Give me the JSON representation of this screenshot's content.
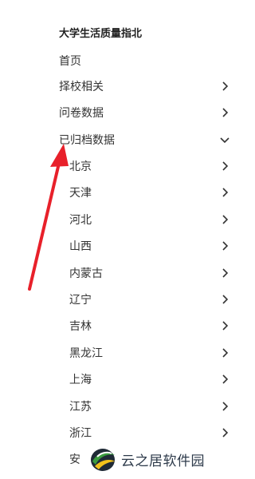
{
  "header": {
    "title": "大学生活质量指北"
  },
  "menu": {
    "home": "首页",
    "school_choice": "择校相关",
    "survey_data": "问卷数据",
    "archived_data": "已归档数据"
  },
  "regions": [
    "北京",
    "天津",
    "河北",
    "山西",
    "内蒙古",
    "辽宁",
    "吉林",
    "黑龙江",
    "上海",
    "江苏",
    "浙江",
    "安"
  ],
  "watermark": {
    "text": "云之居软件园"
  },
  "colors": {
    "arrow": "#e8202a",
    "text": "#333333",
    "chevron": "#333333"
  },
  "icons": {
    "collapsed": "chevron-right-icon",
    "expanded": "chevron-down-icon"
  }
}
